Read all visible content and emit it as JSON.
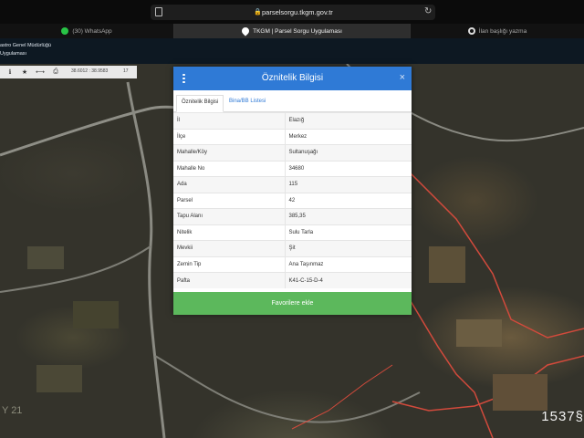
{
  "browser": {
    "url": "parselsorgu.tkgm.gov.tr",
    "tabs": [
      {
        "label": "(30) WhatsApp"
      },
      {
        "label": "TKGM | Parsel Sorgu Uygulaması"
      },
      {
        "label": "İlan başlığı yazma"
      }
    ]
  },
  "site": {
    "title_line1": "astro Genel Müdürlüğü",
    "title_line2": "Uygulaması"
  },
  "toolbar": {
    "info": "ℹ",
    "star": "★",
    "measure": "⟷",
    "print": "⎙",
    "coords": "38.6012 : 38.9583",
    "zoom": "17"
  },
  "modal": {
    "title": "Öznitelik Bilgisi",
    "tabs": [
      "Öznitelik Bilgisi",
      "Bina/BB Listesi"
    ],
    "rows": [
      {
        "label": "İl",
        "value": "Elazığ"
      },
      {
        "label": "İlçe",
        "value": "Merkez"
      },
      {
        "label": "Mahalle/Köy",
        "value": "Sultanuşağı"
      },
      {
        "label": "Mahalle No",
        "value": "34680"
      },
      {
        "label": "Ada",
        "value": "115"
      },
      {
        "label": "Parsel",
        "value": "42"
      },
      {
        "label": "Tapu Alanı",
        "value": "385,35"
      },
      {
        "label": "Nitelik",
        "value": "Sulu Tarla"
      },
      {
        "label": "Mevkii",
        "value": "Şit"
      },
      {
        "label": "Zemin Tip",
        "value": "Ana Taşınmaz"
      },
      {
        "label": "Pafta",
        "value": "K41-C-15-D-4"
      }
    ],
    "button_label": "Favorilere ekle"
  },
  "map": {
    "watermark": "1537§",
    "corner_text": "Y 21"
  },
  "colors": {
    "modal_header": "#2f7ad6",
    "button": "#5cb85c",
    "parcel_line": "#d24a3c"
  }
}
